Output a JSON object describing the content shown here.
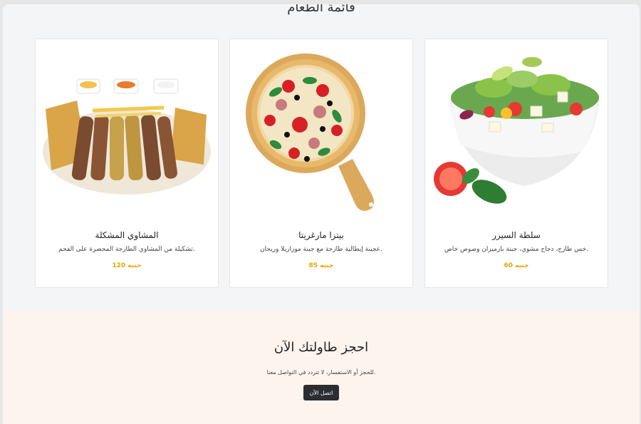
{
  "menu": {
    "title": "قائمة الطعام",
    "items": [
      {
        "name": "المشاوي المشكلة",
        "description": "تشكيلة من المشاوي الطازجة المحضرة على الفحم.",
        "price": "120 جنيه"
      },
      {
        "name": "بيتزا مارغريتا",
        "description": "عجينة إيطالية طازجة مع جبنة موزاريلا وريحان.",
        "price": "85 جنيه"
      },
      {
        "name": "سلطة السيزر",
        "description": "خس طازج، دجاج مشوي، جبنة بارميزان وصوص خاص.",
        "price": "60 جنيه"
      }
    ]
  },
  "reservation": {
    "title": "احجز طاولتك الآن",
    "text": "للحجز أو الاستفسار، لا تتردد في التواصل معنا.",
    "button": "اتصل الآن"
  },
  "colors": {
    "price": "#e0a800",
    "button": "#2b2d30",
    "section_bg": "#fdf4ee"
  }
}
